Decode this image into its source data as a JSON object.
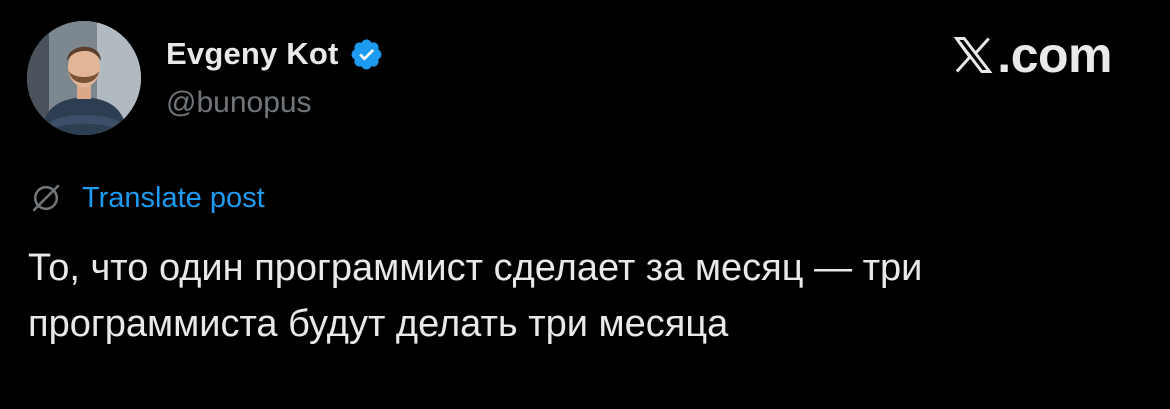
{
  "author": {
    "display_name": "Evgeny Kot",
    "handle": "@bunopus",
    "verified": true,
    "avatar": "profile-photo-man-arms-crossed"
  },
  "brand": {
    "text": ".com",
    "icon": "x-logo-icon"
  },
  "translate": {
    "label": "Translate post",
    "icon": "globe-slash-icon"
  },
  "post": {
    "text": "То, что один программист сделает за месяц — три программиста будут делать три месяца"
  },
  "colors": {
    "background": "#000000",
    "text_primary": "#e7e9ea",
    "text_secondary": "#71767b",
    "accent": "#1d9bf0"
  }
}
